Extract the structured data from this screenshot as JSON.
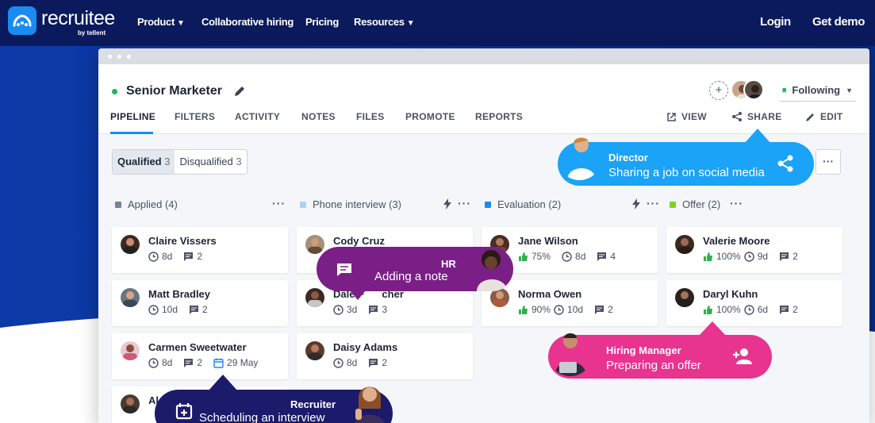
{
  "site": {
    "brand": "recruitee",
    "brand_sub": "by tellent",
    "nav": [
      {
        "label": "Product",
        "dropdown": true
      },
      {
        "label": "Collaborative hiring",
        "dropdown": false
      },
      {
        "label": "Pricing",
        "dropdown": false
      },
      {
        "label": "Resources",
        "dropdown": true
      }
    ],
    "login": "Login",
    "demo": "Get demo",
    "colors": {
      "nav_bg": "#0a1a5c",
      "brand_blue": "#1a8bf0"
    }
  },
  "app": {
    "job_title": "Senior Marketer",
    "following": "Following",
    "tabs": [
      "PIPELINE",
      "FILTERS",
      "ACTIVITY",
      "NOTES",
      "FILES",
      "PROMOTE",
      "REPORTS"
    ],
    "active_tab": "PIPELINE",
    "tools": {
      "view": "VIEW",
      "share": "SHARE",
      "edit": "EDIT"
    },
    "segments": {
      "qualified": {
        "label": "Qualified",
        "count": "3"
      },
      "disqualified": {
        "label": "Disqualified",
        "count": "3"
      }
    },
    "columns": [
      {
        "title": "Applied (4)",
        "color": "#7b8394",
        "cards": [
          {
            "name": "Claire Vissers",
            "days": "8d",
            "comments": "2"
          },
          {
            "name": "Matt Bradley",
            "days": "10d",
            "comments": "2"
          },
          {
            "name": "Carmen Sweetwater",
            "days": "8d",
            "comments": "2",
            "date": "29 May"
          },
          {
            "name": "Al",
            "days": "",
            "comments": ""
          }
        ]
      },
      {
        "title": "Phone interview (3)",
        "color": "#a8d4f5",
        "cards": [
          {
            "name": "Cody Cruz",
            "days": "",
            "comments": ""
          },
          {
            "name": "Dale F",
            "name_end": "cher",
            "days": "3d",
            "comments": "3"
          },
          {
            "name": "Daisy Adams",
            "days": "8d",
            "comments": "2"
          }
        ]
      },
      {
        "title": "Evaluation (2)",
        "color": "#1a8bf0",
        "cards": [
          {
            "name": "Jane Wilson",
            "score": "75%",
            "days": "8d",
            "comments": "4"
          },
          {
            "name": "Norma Owen",
            "score": "90%",
            "days": "10d",
            "comments": "2"
          }
        ]
      },
      {
        "title": "Offer (2)",
        "color": "#7ed321",
        "cards": [
          {
            "name": "Valerie Moore",
            "score": "100%",
            "days": "9d",
            "comments": "2"
          },
          {
            "name": "Daryl Kuhn",
            "score": "100%",
            "days": "6d",
            "comments": "2"
          }
        ]
      }
    ]
  },
  "callouts": {
    "director": {
      "role": "Director",
      "task": "Sharing a job on social media",
      "color": "#1aa3f7"
    },
    "hr": {
      "role": "HR",
      "task": "Adding a note",
      "color": "#7a1f86"
    },
    "hiring_manager": {
      "role": "Hiring Manager",
      "task": "Preparing an offer",
      "color": "#e8338f"
    },
    "recruiter": {
      "role": "Recruiter",
      "task": "Scheduling an interview",
      "color": "#1b1a6b"
    }
  }
}
